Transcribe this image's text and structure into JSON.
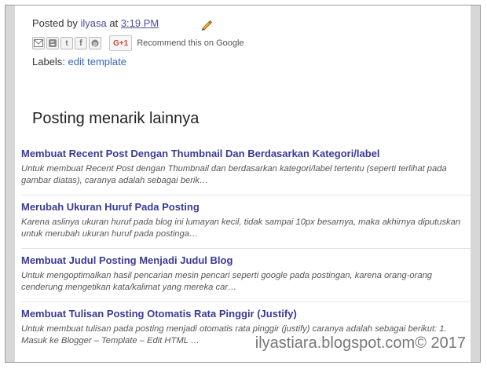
{
  "post_footer": {
    "posted_by_label": "Posted by",
    "author": "ilyasa",
    "at_label": "at",
    "time": "3:19 PM"
  },
  "share": {
    "buttons": [
      "email",
      "blog",
      "twitter",
      "facebook",
      "pinterest"
    ],
    "gplus_label": "G+1",
    "recommend_text": "Recommend this on Google"
  },
  "labels": {
    "label": "Labels:",
    "value": "edit template"
  },
  "related": {
    "heading": "Posting menarik lainnya",
    "items": [
      {
        "title": "Membuat Recent Post Dengan Thumbnail Dan Berdasarkan Kategori/label",
        "desc": "Untuk membuat Recent Post dengan Thumbnail dan berdasarkan kategori/label tertentu (seperti terlihat pada gambar diatas), caranya adalah sebagai berik…"
      },
      {
        "title": "Merubah Ukuran Huruf Pada Posting",
        "desc": "Karena aslinya ukuran huruf pada blog ini lumayan kecil, tidak sampai 10px besarnya, maka akhirnya diputuskan untuk merubah ukuran huruf pada postinga…"
      },
      {
        "title": "Membuat Judul Posting Menjadi Judul Blog",
        "desc": "Untuk mengoptimalkan hasil pencarian mesin pencari seperti google pada postingan, karena orang-orang cenderung mengetikan kata/kalimat yang mereka car…"
      },
      {
        "title": "Membuat Tulisan Posting Otomatis Rata Pinggir (Justify)",
        "desc": "Untuk membuat tulisan pada posting menjadi otomatis rata pinggir (justify) caranya adalah sebagai berikut: 1. Masuk ke Blogger – Template – Edit HTML …"
      }
    ]
  },
  "watermark": "ilyastiara.blogspot.com© 2017",
  "colors": {
    "link": "#3a3a96",
    "label_link": "#3366bb",
    "gutter": "#d7d7d7",
    "gplus": "#d34836"
  }
}
